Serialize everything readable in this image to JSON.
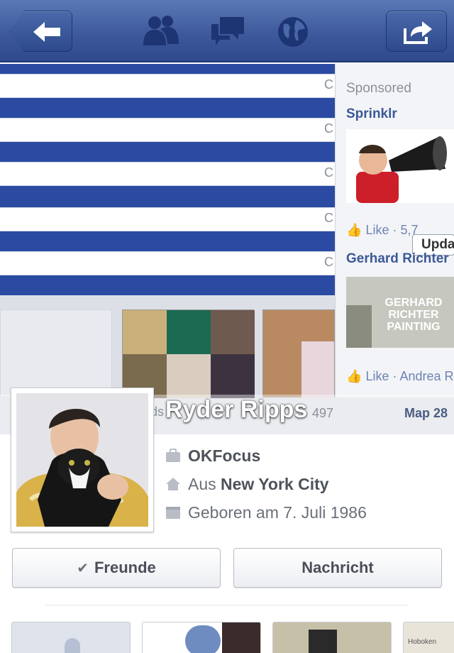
{
  "header": {
    "back_icon": "back-arrow-icon",
    "friends_icon": "friends-icon",
    "messages_icon": "messages-icon",
    "notifications_icon": "globe-icon",
    "share_icon": "share-icon"
  },
  "cover": {
    "stripe_marker": "C",
    "sponsored": {
      "label": "Sponsored",
      "ad1": {
        "name": "Sprinklr",
        "like": "Like · 5,7"
      },
      "ad2": {
        "name": "Gerhard Richter",
        "image_text": "GERHARD RICHTER PAINTING",
        "like": "Like · Andrea R"
      },
      "tooltip": "Upda"
    },
    "ds_fragment": "ds",
    "count_fragment": "497",
    "map_link": "Map 28"
  },
  "profile": {
    "name": "Ryder Ripps",
    "work": "OKFocus",
    "from_prefix": "Aus ",
    "from_place": "New York City",
    "born": "Geboren am 7. Juli 1986"
  },
  "actions": {
    "friends_label": "Freunde",
    "message_label": "Nachricht"
  },
  "bottom": {
    "map_fragment": "Hoboken"
  },
  "colors": {
    "nav_blue": "#3e5a9c",
    "link_blue": "#3b5998",
    "stripe_blue": "#2b4ba2"
  }
}
